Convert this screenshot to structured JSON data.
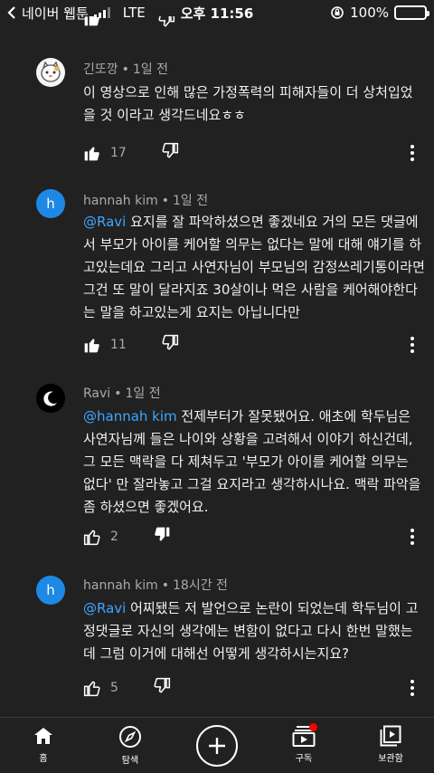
{
  "status_bar": {
    "carrier": "네이버 웹툰",
    "network": "LTE",
    "time": "오후 11:56",
    "battery": "100%"
  },
  "comments": [
    {
      "author": "긴또깡",
      "time": "1일 전",
      "avatar_letter": "",
      "mention": "",
      "text": "이 영상으로 인해 많은 가정폭력의 피해자들이 더 상처입었을 것 이라고 생각드네요ㅎㅎ",
      "likes": "17",
      "liked": false,
      "disliked": false
    },
    {
      "author": "hannah kim",
      "time": "1일 전",
      "avatar_letter": "h",
      "mention": "@Ravi",
      "text": " 요지를 잘 파악하셨으면 좋겠네요 거의 모든 댓글에서 부모가 아이를 케어할 의무는 없다는 말에 대해 얘기를 하고있는데요 그리고 사연자님이 부모님의 감정쓰레기통이라면 그건 또 말이 달라지죠 30살이나 먹은 사람을 케어해야한다는 말을 하고있는게 요지는 아닙니다만",
      "likes": "11",
      "liked": false,
      "disliked": false
    },
    {
      "author": "Ravi",
      "time": "1일 전",
      "avatar_letter": "",
      "mention": "@hannah kim",
      "text": "  전제부터가 잘못됐어요. 애초에 학두님은 사연자님께 들은 나이와 상황을 고려해서 이야기 하신건데, 그 모든 맥락을 다 제쳐두고 '부모가 아이를 케어할 의무는 없다' 만 잘라놓고 그걸 요지라고 생각하시나요. 맥락 파악을 좀 하셨으면 좋겠어요.",
      "likes": "2",
      "liked": false,
      "disliked": true
    },
    {
      "author": "hannah kim",
      "time": "18시간 전",
      "avatar_letter": "h",
      "mention": "@Ravi",
      "text": " 어찌됐든 저 발언으로 논란이 되었는데 학두님이 고정댓글로 자신의 생각에는 변함이 없다고 다시 한번 말했는데 그럼 이거에 대해선 어떻게 생각하시는지요?",
      "likes": "5",
      "liked": false,
      "disliked": false
    }
  ],
  "nav": {
    "home": "홈",
    "explore": "탐색",
    "subscriptions": "구독",
    "library": "보관함"
  },
  "colors": {
    "background": "#212121",
    "mention": "#3ea6ff",
    "avatar_h": "#1e88e5",
    "badge": "#ff0000"
  }
}
